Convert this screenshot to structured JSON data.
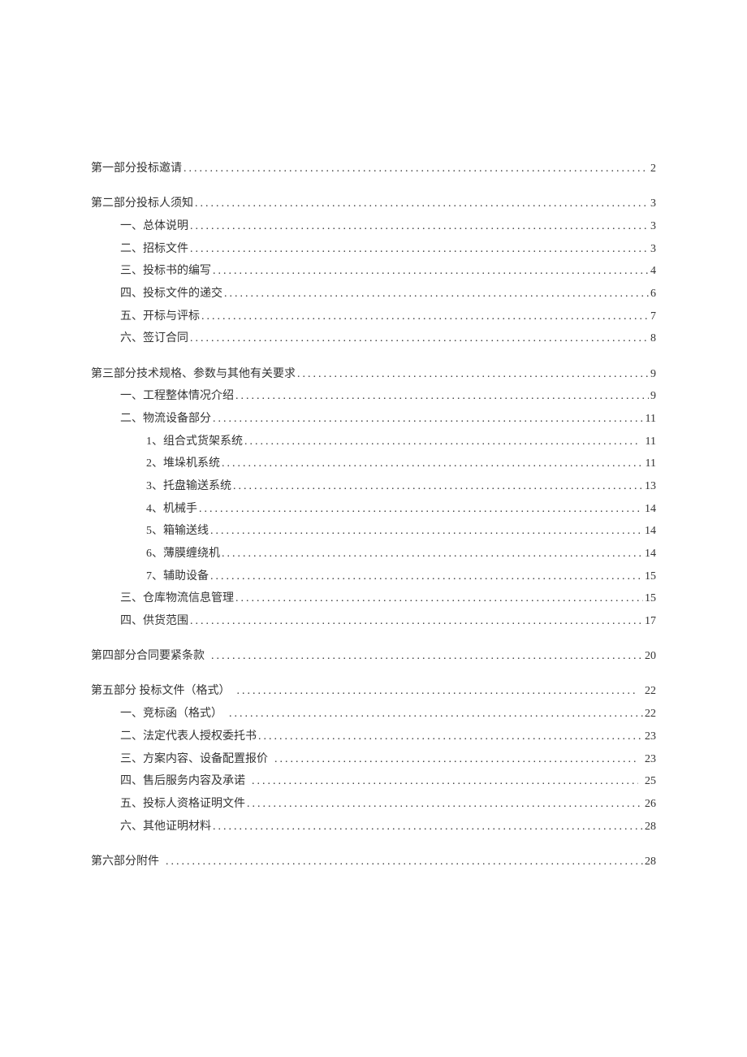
{
  "toc": [
    {
      "items": [
        {
          "level": 0,
          "title": "第一部分投标邀请",
          "page": "2"
        }
      ]
    },
    {
      "items": [
        {
          "level": 0,
          "title": "第二部分投标人须知",
          "page": "3"
        },
        {
          "level": 1,
          "title": "一、总体说明",
          "page": "3"
        },
        {
          "level": 1,
          "title": "二、招标文件",
          "page": "3"
        },
        {
          "level": 1,
          "title": "三、投标书的编写",
          "page": "4"
        },
        {
          "level": 1,
          "title": "四、投标文件的递交",
          "page": "6"
        },
        {
          "level": 1,
          "title": "五、开标与评标",
          "page": "7"
        },
        {
          "level": 1,
          "title": "六、签订合同",
          "page": "8"
        }
      ]
    },
    {
      "items": [
        {
          "level": 0,
          "title": "第三部分技术规格、参数与其他有关要求",
          "page": "9"
        },
        {
          "level": 1,
          "title": "一、工程整体情况介绍",
          "page": "9"
        },
        {
          "level": 1,
          "title": "二、物流设备部分",
          "page": "11"
        },
        {
          "level": 2,
          "title": "1、组合式货架系统",
          "page": "11",
          "pageSpace": true
        },
        {
          "level": 2,
          "title": "2、堆垛机系统",
          "page": "11"
        },
        {
          "level": 2,
          "title": "3、托盘输送系统",
          "page": "13"
        },
        {
          "level": 2,
          "title": "4、机械手",
          "page": "14"
        },
        {
          "level": 2,
          "title": "5、箱输送线",
          "page": "14"
        },
        {
          "level": 2,
          "title": "6、薄膜缠绕机",
          "page": "14"
        },
        {
          "level": 2,
          "title": "7、辅助设备",
          "page": "15"
        },
        {
          "level": 1,
          "title": "三、仓库物流信息管理",
          "page": "15"
        },
        {
          "level": 1,
          "title": "四、供货范围",
          "page": "17"
        }
      ]
    },
    {
      "items": [
        {
          "level": 0,
          "title": "第四部分合同要紧条款",
          "page": "20",
          "titleSpace": true
        }
      ]
    },
    {
      "items": [
        {
          "level": 0,
          "title": "第五部分 投标文件（格式）",
          "page": "22",
          "titleSpace": true,
          "pageSpace": true
        },
        {
          "level": 1,
          "title": "一、竞标函（格式）",
          "page": "22",
          "titleSpace": true
        },
        {
          "level": 1,
          "title": "二、法定代表人授权委托书",
          "page": "23"
        },
        {
          "level": 1,
          "title": "三、方案内容、设备配置报价",
          "page": "23",
          "titleSpace": true,
          "pageSpace": true
        },
        {
          "level": 1,
          "title": "四、售后服务内容及承诺",
          "page": "25",
          "titleSpace": true,
          "pageSpace": true
        },
        {
          "level": 1,
          "title": "五、投标人资格证明文件",
          "page": "26"
        },
        {
          "level": 1,
          "title": "六、其他证明材料",
          "page": "28"
        }
      ]
    },
    {
      "items": [
        {
          "level": 0,
          "title": "第六部分附件",
          "page": "28",
          "titleSpace": true
        }
      ]
    }
  ]
}
